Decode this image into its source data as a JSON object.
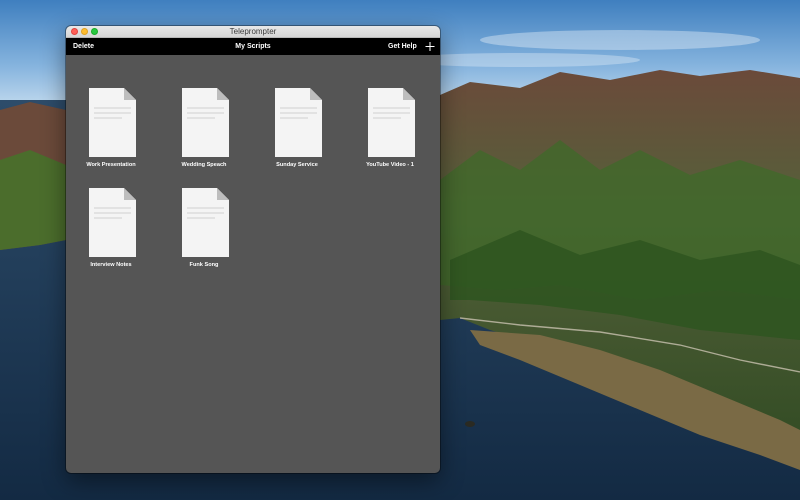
{
  "window": {
    "title": "Teleprompter"
  },
  "toolbar": {
    "delete_label": "Delete",
    "title": "My Scripts",
    "help_label": "Get Help",
    "add_icon": "plus-icon"
  },
  "scripts": [
    {
      "name": "Work Presentation"
    },
    {
      "name": "Wedding Speach"
    },
    {
      "name": "Sunday Service"
    },
    {
      "name": "YouTube Video - 1"
    },
    {
      "name": "Interview Notes"
    },
    {
      "name": "Funk Song"
    }
  ],
  "colors": {
    "window_background": "#555555",
    "toolbar_background": "#000000",
    "toolbar_text": "#ffffff",
    "document_page": "#f4f4f4"
  }
}
